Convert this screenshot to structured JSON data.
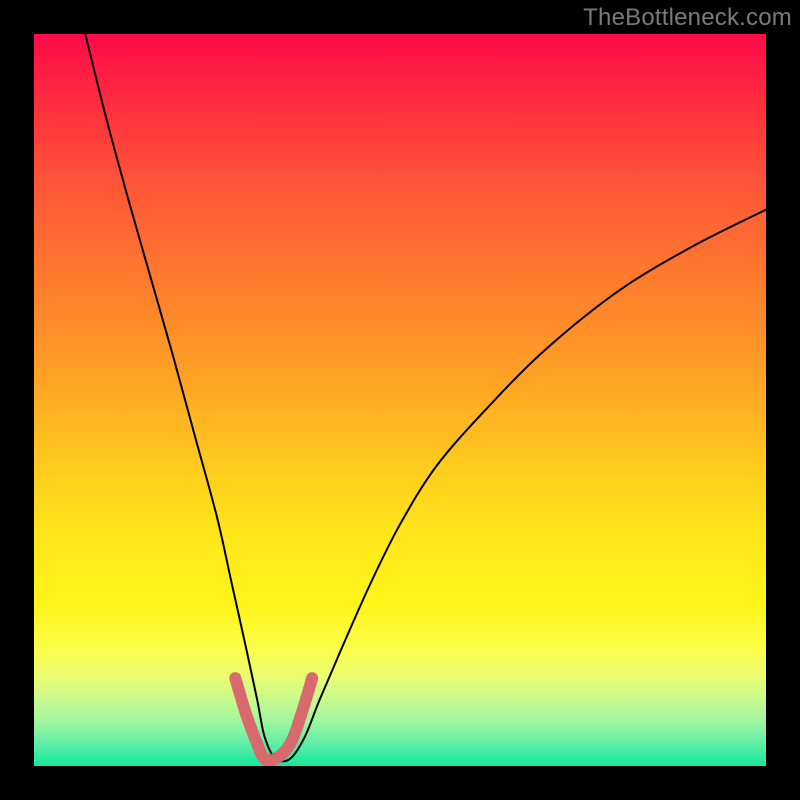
{
  "watermark": "TheBottleneck.com",
  "chart_data": {
    "type": "line",
    "title": "",
    "xlabel": "",
    "ylabel": "",
    "xlim": [
      0,
      100
    ],
    "ylim": [
      0,
      100
    ],
    "gradient_stops": [
      {
        "pos": 0,
        "color": "#ff0b48"
      },
      {
        "pos": 10,
        "color": "#ff2f3e"
      },
      {
        "pos": 22,
        "color": "#ff5a36"
      },
      {
        "pos": 34,
        "color": "#ff7c2d"
      },
      {
        "pos": 48,
        "color": "#ffa524"
      },
      {
        "pos": 58,
        "color": "#ffc81e"
      },
      {
        "pos": 68,
        "color": "#ffe51a"
      },
      {
        "pos": 78,
        "color": "#fff51a"
      },
      {
        "pos": 84,
        "color": "#fcfd4a"
      },
      {
        "pos": 88,
        "color": "#eafb73"
      },
      {
        "pos": 91,
        "color": "#c7f98e"
      },
      {
        "pos": 94,
        "color": "#9ef6a0"
      },
      {
        "pos": 97,
        "color": "#5deea6"
      },
      {
        "pos": 100,
        "color": "#15e69d"
      }
    ],
    "series": [
      {
        "name": "black-curve",
        "color": "#000000",
        "stroke_width": 2,
        "x": [
          7,
          10,
          13,
          16,
          19,
          22,
          25,
          27,
          29,
          30.5,
          31.5,
          33,
          35,
          37,
          39,
          42,
          46,
          50,
          55,
          62,
          70,
          80,
          90,
          100
        ],
        "y": [
          100,
          88,
          77,
          66.5,
          56,
          45,
          34,
          25,
          16,
          9,
          4,
          1,
          1,
          4,
          9,
          16,
          25,
          33,
          41,
          49,
          57,
          65,
          71,
          76
        ]
      },
      {
        "name": "pink-segment",
        "color": "#d86a6d",
        "stroke_width": 12,
        "x": [
          27.5,
          29,
          30.5,
          31.5,
          33,
          35,
          36.5,
          38
        ],
        "y": [
          12,
          7,
          3,
          1,
          1,
          3,
          7,
          12
        ]
      }
    ],
    "note": "Axes are unlabeled in the source image; x/y are normalized 0–100. y runs upward (100 = top of plot)."
  }
}
